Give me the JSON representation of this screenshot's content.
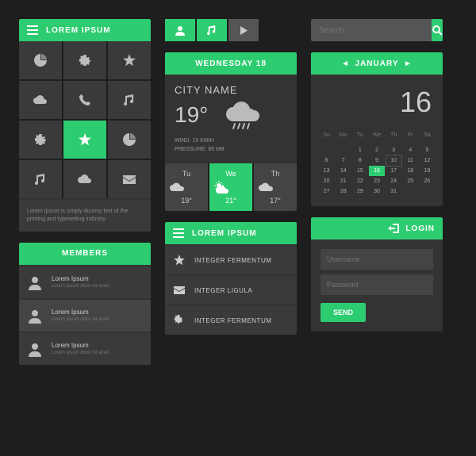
{
  "sidebar": {
    "title": "LOREM IPSUM",
    "footer": "Lorem Ipsum is simply dummy text of the printing and typesetting industry."
  },
  "weather": {
    "header": "WEDNESDAY 18",
    "city": "CITY NAME",
    "temp": "19°",
    "wind": "WIND: 15 KM/H",
    "pressure": "PRESSURE: 85 MB",
    "forecast": [
      {
        "day": "Tu",
        "temp": "19°"
      },
      {
        "day": "We",
        "temp": "21°"
      },
      {
        "day": "Th",
        "temp": "17°"
      }
    ]
  },
  "search": {
    "placeholder": "Search"
  },
  "calendar": {
    "month": "JANUARY",
    "date": "16",
    "dow": [
      "Su",
      "Mo",
      "Tu",
      "We",
      "Th",
      "Fr",
      "Sa"
    ],
    "weeks": [
      [
        "",
        "",
        "1",
        "2",
        "3",
        "4",
        "5"
      ],
      [
        "6",
        "7",
        "8",
        "9",
        "10",
        "11",
        "12"
      ],
      [
        "13",
        "14",
        "15",
        "16",
        "17",
        "18",
        "19"
      ],
      [
        "20",
        "21",
        "22",
        "23",
        "24",
        "25",
        "26"
      ],
      [
        "27",
        "28",
        "29",
        "30",
        "31",
        "",
        ""
      ]
    ]
  },
  "members": {
    "title": "MEMBERS",
    "items": [
      {
        "name": "Lorem Ipsum",
        "sub": "Lorem ipsum dolor sit amet"
      },
      {
        "name": "Lorem Ipsum",
        "sub": "Lorem ipsum dolor sit amet"
      },
      {
        "name": "Lorem Ipsum",
        "sub": "Lorem ipsum dolor sit amet"
      }
    ]
  },
  "list": {
    "title": "LOREM IPSUM",
    "items": [
      "INTEGER FERMENTUM",
      "INTEGER LIGULA",
      "INTEGER FERMENTUM"
    ]
  },
  "login": {
    "title": "LOGIN",
    "username": "Username",
    "password": "Password",
    "send": "SEND"
  }
}
